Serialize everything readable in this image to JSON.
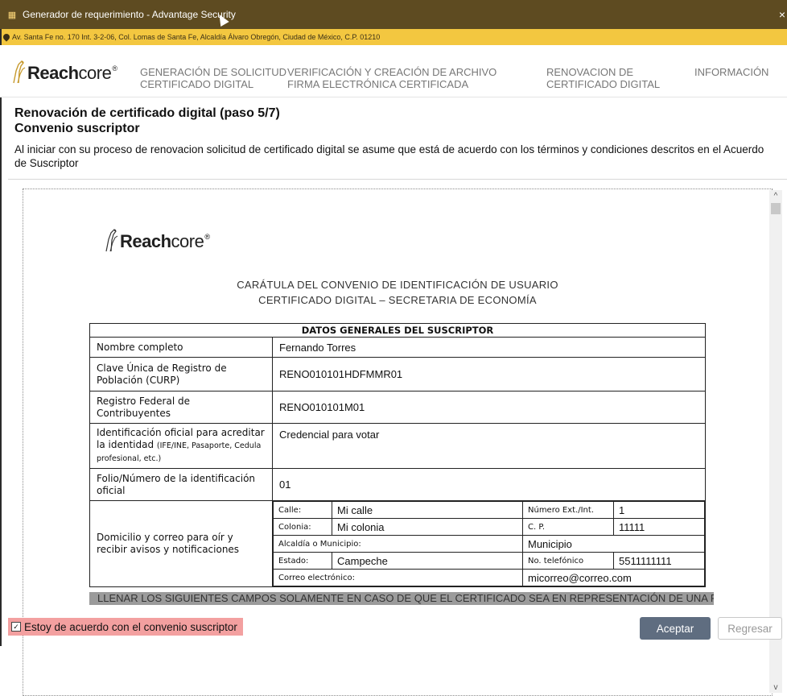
{
  "window": {
    "title": "Generador de requerimiento - Advantage Security",
    "close_glyph": "×"
  },
  "address": {
    "text": "Av. Santa Fe no. 170 Int. 3-2-06, Col. Lomas de Santa Fe, Alcaldía Álvaro Obregón, Ciudad de México, C.P. 01210"
  },
  "brand": {
    "reach": "Reach",
    "core": "core",
    "reg": "®"
  },
  "nav": {
    "items": [
      {
        "line1": "GENERACIÓN DE SOLICITUD",
        "line2": "CERTIFICADO DIGITAL"
      },
      {
        "line1": "VERIFICACIÓN Y CREACIÓN DE ARCHIVO",
        "line2": "FIRMA ELECTRÓNICA CERTIFICADA"
      },
      {
        "line1": "RENOVACION DE",
        "line2": "CERTIFICADO DIGITAL"
      },
      {
        "line1": "INFORMACIÓN",
        "line2": ""
      }
    ]
  },
  "page": {
    "title": "Renovación de certificado digital (paso 5/7)",
    "subtitle": "Convenio suscriptor",
    "intro": "Al iniciar con su proceso de renovacion solicitud de certificado digital se asume que está de acuerdo con los términos y condiciones descritos en el Acuerdo de Suscriptor"
  },
  "document": {
    "heading_line1": "CARÁTULA DEL CONVENIO DE IDENTIFICACIÓN DE USUARIO",
    "heading_line2": "CERTIFICADO DIGITAL – SECRETARIA DE ECONOMÍA",
    "section_title": "DATOS GENERALES DEL SUSCRIPTOR",
    "rows": [
      {
        "label": "Nombre completo",
        "value": "Fernando Torres"
      },
      {
        "label": "Clave Única de Registro de Población (CURP)",
        "value": "RENO010101HDFMMR01"
      },
      {
        "label": "Registro Federal de Contribuyentes",
        "value": "RENO010101M01"
      },
      {
        "label": "Identificación oficial para acreditar la identidad",
        "label_small": "(IFE/INE, Pasaporte, Cedula profesional, etc.)",
        "value": "Credencial para votar"
      },
      {
        "label": "Folio/Número de la identificación oficial",
        "value": "01"
      }
    ],
    "address_label": "Domicilio y correo para oír y recibir avisos y notificaciones",
    "address": {
      "calle_label": "Calle:",
      "calle": "Mi calle",
      "numero_label": "Número Ext./Int.",
      "numero": "1",
      "colonia_label": "Colonia:",
      "colonia": "Mi colonia",
      "cp_label": "C. P.",
      "cp": "11111",
      "municipio_label": "Alcaldía o Municipio:",
      "municipio": "Municipio",
      "estado_label": "Estado:",
      "estado": "Campeche",
      "telefono_label": "No. telefónico",
      "telefono": "5511111111",
      "correo_label": "Correo electrónico:",
      "correo": "micorreo@correo.com"
    },
    "footer_band": "LLENAR LOS SIGUIENTES CAMPOS SOLAMENTE EN CASO DE QUE EL CERTIFICADO SEA EN REPRESENTACIÓN DE UNA PERSONA"
  },
  "footer": {
    "agree_label": "Estoy de acuerdo con el convenio suscriptor",
    "agree_checked": true,
    "accept_label": "Aceptar",
    "back_label": "Regresar"
  },
  "colors": {
    "titlebar": "#5e4b21",
    "addressbar": "#f3c740",
    "agree_highlight": "#f3a0a0",
    "accept_button": "#5f6d80"
  },
  "icons": {
    "app": "app-icon",
    "pin": "location-pin-icon",
    "logo": "giraffe-logo-icon"
  }
}
